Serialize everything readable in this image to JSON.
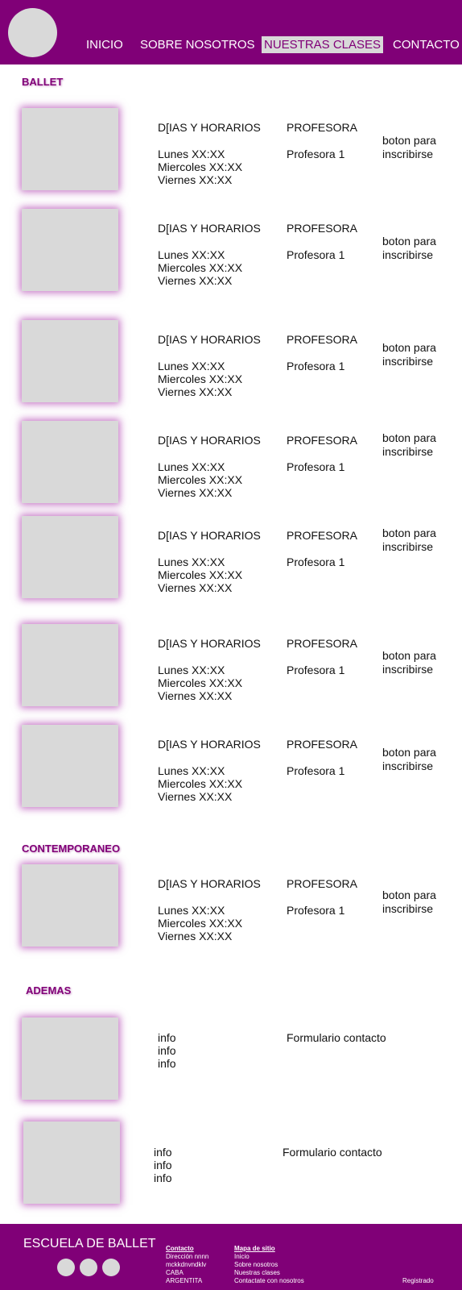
{
  "nav": {
    "items": [
      "INICIO",
      "SOBRE NOSOTROS",
      "NUESTRAS CLASES",
      "CONTACTO"
    ],
    "active": "NUESTRAS CLASES"
  },
  "sections": {
    "ballet": "BALLET",
    "contemporaneo": "CONTEMPORANEO",
    "ademas": "ADEMAS"
  },
  "class_card": {
    "schedule_header": "D[IAS Y HORARIOS",
    "schedule_lines": [
      "Lunes XX:XX",
      "Miercoles XX:XX",
      "Viernes XX:XX"
    ],
    "teacher_header": "PROFESORA",
    "teacher_name": "Profesora 1",
    "enroll_button": "boton para inscribirse"
  },
  "extra_card": {
    "info_lines": [
      "info",
      "info",
      "info"
    ],
    "form_label": "Formulario contacto"
  },
  "footer": {
    "brand": "ESCUELA DE BALLET",
    "contact_title": "Contacto",
    "contact_lines": [
      "Dirección nnnn",
      "mckkdnvndklv",
      "CABA",
      "ARGENTITA"
    ],
    "sitemap_title": "Mapa de sitio",
    "sitemap_lines": [
      "Inicio",
      "Sobre nosotros",
      "Nuestras clases",
      "Contactate con nosotros"
    ],
    "registered": "Registrado"
  }
}
